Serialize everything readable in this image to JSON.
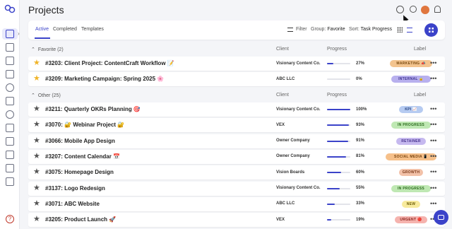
{
  "app": {
    "title": "Projects"
  },
  "toolbar": {
    "tabs": [
      "Active",
      "Completed",
      "Templates"
    ],
    "filter_label": "Filter",
    "group_label": "Group:",
    "group_value": "Favorite",
    "sort_label": "Sort:",
    "sort_value": "Task Progress"
  },
  "columns": {
    "client": "Client",
    "progress": "Progress",
    "label": "Label"
  },
  "sections": [
    {
      "title": "Favorite (2)",
      "rows": [
        {
          "title": "#3203: Client Project: ContentCraft Workflow 📝",
          "client": "Visionary Content Co.",
          "progress": 27,
          "progress_text": "27%",
          "label": "MARKETING 📣",
          "label_bg": "#f3c48f",
          "label_fg": "#7a4a10",
          "favorite": true
        },
        {
          "title": "#3209: Marketing Campaign: Spring 2025 🌸",
          "client": "ABC LLC",
          "progress": 0,
          "progress_text": "0%",
          "label": "INTERNAL 🔒",
          "label_bg": "#b8b0ee",
          "label_fg": "#3e3290",
          "favorite": true
        }
      ]
    },
    {
      "title": "Other (25)",
      "rows": [
        {
          "title": "#3211: Quarterly OKRs Planning 🎯",
          "client": "Visionary Content Co.",
          "progress": 100,
          "progress_text": "100%",
          "label": "KPI 📈",
          "label_bg": "#b6cbf1",
          "label_fg": "#24407f",
          "favorite": false
        },
        {
          "title": "#3070: 🔐 Webinar Project 🔐",
          "client": "VEX",
          "progress": 93,
          "progress_text": "93%",
          "label": "IN PROGRESS",
          "label_bg": "#bfe8b3",
          "label_fg": "#2a6b1c",
          "favorite": false
        },
        {
          "title": "#3066: Mobile App Design",
          "client": "Owner Company",
          "progress": 91,
          "progress_text": "91%",
          "label": "RETAINER",
          "label_bg": "#c6b9ef",
          "label_fg": "#47338f",
          "favorite": false
        },
        {
          "title": "#3207: Content Calendar 📅",
          "client": "Owner Company",
          "progress": 81,
          "progress_text": "81%",
          "label": "SOCIAL MEDIA 📱",
          "label_bg": "#f6c08a",
          "label_fg": "#7a4510",
          "favorite": false
        },
        {
          "title": "#3075: Homepage Design",
          "client": "Vision Boards",
          "progress": 60,
          "progress_text": "60%",
          "label": "GROWTH",
          "label_bg": "#f2c1a8",
          "label_fg": "#7c3a1a",
          "favorite": false
        },
        {
          "title": "#3137: Logo Redesign",
          "client": "Visionary Content Co.",
          "progress": 55,
          "progress_text": "55%",
          "label": "IN PROGRESS",
          "label_bg": "#bfe8b3",
          "label_fg": "#2a6b1c",
          "favorite": false
        },
        {
          "title": "#3071: ABC Website",
          "client": "ABC LLC",
          "progress": 33,
          "progress_text": "33%",
          "label": "NEW",
          "label_bg": "#f7ea9c",
          "label_fg": "#6e5d08",
          "favorite": false
        },
        {
          "title": "#3205: Product Launch 🚀",
          "client": "VEX",
          "progress": 19,
          "progress_text": "19%",
          "label": "URGENT 🔴",
          "label_bg": "#f5b3ae",
          "label_fg": "#8a1f17",
          "favorite": false
        }
      ]
    }
  ],
  "colors": {
    "accent": "#3b43c9",
    "favorite_star": "#f0b429"
  }
}
